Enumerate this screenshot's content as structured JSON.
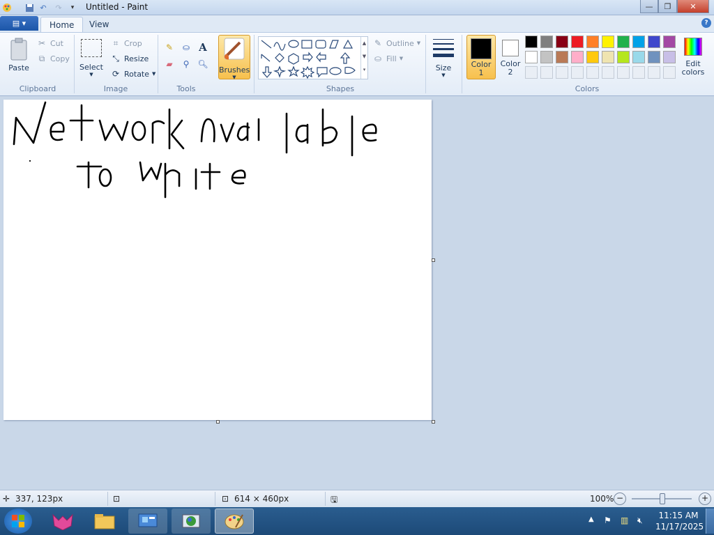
{
  "window": {
    "title": "Untitled - Paint"
  },
  "tabs": [
    {
      "label": "Home"
    },
    {
      "label": "View"
    }
  ],
  "clipboard": {
    "paste": "Paste",
    "cut": "Cut",
    "copy": "Copy",
    "group": "Clipboard"
  },
  "image": {
    "select": "Select",
    "crop": "Crop",
    "resize": "Resize",
    "rotate": "Rotate",
    "group": "Image"
  },
  "tools": {
    "group": "Tools",
    "items": [
      "pencil-icon",
      "fill-icon",
      "text-icon",
      "eraser-icon",
      "color-picker-icon",
      "magnifier-icon"
    ]
  },
  "brushes": {
    "label": "Brushes"
  },
  "shapes": {
    "group": "Shapes",
    "outline": "Outline",
    "fill": "Fill"
  },
  "size": {
    "label": "Size"
  },
  "colors": {
    "group": "Colors",
    "color1": "Color\n1",
    "color1_a": "Color",
    "color1_b": "1",
    "color2_a": "Color",
    "color2_b": "2",
    "edit_a": "Edit",
    "edit_b": "colors",
    "color1_value": "#000000",
    "color2_value": "#ffffff",
    "row1": [
      "#000000",
      "#7f7f7f",
      "#880015",
      "#ed1c24",
      "#ff7f27",
      "#fff200",
      "#22b14c",
      "#00a2e8",
      "#3f48cc",
      "#a349a4"
    ],
    "row2": [
      "#ffffff",
      "#c3c3c3",
      "#b97a57",
      "#ffaec9",
      "#ffc90e",
      "#efe4b0",
      "#b5e61d",
      "#99d9ea",
      "#7092be",
      "#c8bfe7"
    ]
  },
  "drawing": {
    "line1": "Network Available",
    "line2": "to white"
  },
  "status": {
    "cursor": "337, 123px",
    "canvas_size": "614 × 460px",
    "zoom": "100%"
  },
  "taskbar": {
    "time": "11:15 AM",
    "date": "11/17/2025"
  }
}
